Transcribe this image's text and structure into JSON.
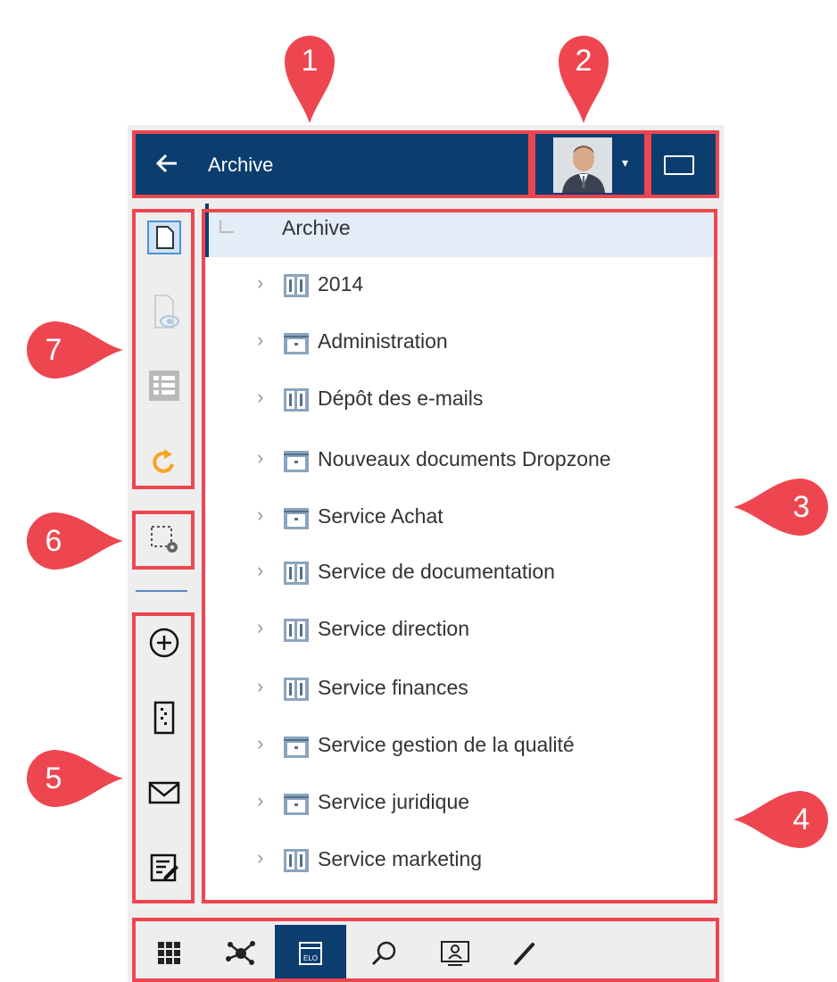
{
  "header": {
    "back_icon": "arrow-left-icon",
    "title": "Archive",
    "caret": "▾"
  },
  "tree": {
    "root_label": "Archive",
    "items": [
      {
        "label": "2014",
        "icon": "binder-icon"
      },
      {
        "label": "Administration",
        "icon": "cabinet-icon"
      },
      {
        "label": "Dépôt des e-mails",
        "icon": "binder-icon"
      },
      {
        "label": "Nouveaux documents Dropzone",
        "icon": "cabinet-icon"
      },
      {
        "label": "Service Achat",
        "icon": "cabinet-icon"
      },
      {
        "label": "Service de documentation",
        "icon": "binder-icon"
      },
      {
        "label": "Service direction",
        "icon": "binder-icon"
      },
      {
        "label": "Service finances",
        "icon": "binder-icon"
      },
      {
        "label": "Service gestion de la qualité",
        "icon": "cabinet-icon"
      },
      {
        "label": "Service juridique",
        "icon": "cabinet-icon"
      },
      {
        "label": "Service marketing",
        "icon": "binder-icon"
      }
    ]
  },
  "bottom_nav": {
    "active_label": "ELO"
  },
  "callouts": [
    "1",
    "2",
    "3",
    "4",
    "5",
    "6",
    "7"
  ],
  "colors": {
    "header": "#0b3d6e",
    "callout": "#ee4650",
    "accent_orange": "#f5a623",
    "row_selected": "#e3edf7"
  }
}
